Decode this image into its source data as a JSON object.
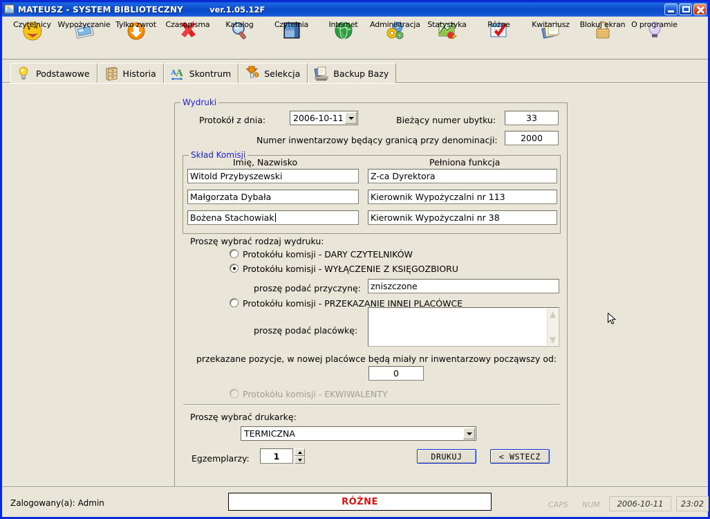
{
  "window": {
    "title": "MATEUSZ - SYSTEM BIBLIOTECZNY",
    "version": "ver.1.05.12F",
    "icon": "application-icon",
    "controls": {
      "minimize": "minimize-button",
      "maximize": "maximize-button",
      "close": "close-button"
    }
  },
  "toolbar": {
    "items": [
      {
        "label": "Czytelnicy",
        "icon": "smiley-face-icon"
      },
      {
        "label": "Wypożyczanie",
        "icon": "book-card-icon"
      },
      {
        "label": "Tylko zwrot",
        "icon": "orange-down-arrow-icon"
      },
      {
        "label": "Czasopisma",
        "icon": "red-x-icon"
      },
      {
        "label": "Katalog",
        "icon": "magnifier-icon"
      },
      {
        "label": "Czytelnia",
        "icon": "map-book-icon"
      },
      {
        "label": "Internet",
        "icon": "globe-icon"
      },
      {
        "label": "Administracja",
        "icon": "gears-icon"
      },
      {
        "label": "Statystyka",
        "icon": "chart-icon"
      },
      {
        "label": "Różne",
        "icon": "calendar-check-icon"
      },
      {
        "label": "Kwitariusz",
        "icon": "documents-icon"
      },
      {
        "label": "Blokuj ekran",
        "icon": "padlock-icon"
      },
      {
        "label": "O programie",
        "icon": "lightbulb-icon"
      }
    ]
  },
  "tabs": [
    {
      "label": "Podstawowe",
      "icon": "lightbulb-icon",
      "selected": true
    },
    {
      "label": "Historia",
      "icon": "file-cabinet-icon",
      "selected": false
    },
    {
      "label": "Skontrum",
      "icon": "font-size-icon",
      "selected": false
    },
    {
      "label": "Selekcja",
      "icon": "funnel-icon",
      "selected": false
    },
    {
      "label": "Backup Bazy",
      "icon": "backup-documents-icon",
      "selected": false
    }
  ],
  "form": {
    "printouts_group_label": "Wydruki",
    "protocol_date_label": "Protokół z dnia:",
    "protocol_date_value": "2006-10-11",
    "current_loss_number_label": "Bieżący numer ubytku:",
    "current_loss_number_value": "33",
    "denomination_limit_label": "Numer inwentarzowy będący granicą przy denominacji:",
    "denomination_limit_value": "2000",
    "committee_group_label": "Skład Komisji",
    "committee_col_name": "Imię, Nazwisko",
    "committee_col_function": "Pełniona funkcja",
    "committee": [
      {
        "name": "Witold Przybyszewski",
        "function": "Z-ca Dyrektora"
      },
      {
        "name": "Małgorzata Dybała",
        "function": "Kierownik Wypożyczalni nr 113"
      },
      {
        "name": "Bożena Stachowiak",
        "function": "Kierownik Wypożyczalni nr 38"
      }
    ],
    "printout_type_label": "Proszę wybrać rodzaj wydruku:",
    "options": [
      {
        "label": "Protokółu komisji - DARY CZYTELNIKÓW",
        "selected": false,
        "disabled": false
      },
      {
        "label": "Protokółu komisji - WYŁĄCZENIE Z KSIĘGOZBIORU",
        "selected": true,
        "disabled": false
      },
      {
        "label": "Protokółu komisji - PRZEKAZANIE INNEJ PLACÓWCE",
        "selected": false,
        "disabled": false
      },
      {
        "label": "Protokółu komisji - EKWIWALENTY",
        "selected": false,
        "disabled": true
      }
    ],
    "reason_label": "proszę podać przyczynę:",
    "reason_value": "zniszczone",
    "institution_label": "proszę podać placówkę:",
    "institution_value": "",
    "transfer_note": "przekazane pozycje, w nowej placówce będą miały nr inwentarzowy począwszy od:",
    "transfer_start_value": "0",
    "printer_label": "Proszę wybrać drukarkę:",
    "printer_value": "TERMICZNA",
    "copies_label": "Egzemplarzy:",
    "copies_value": "1",
    "print_button": "DRUKUJ",
    "back_button": "< WSTECZ"
  },
  "statusbar": {
    "user": "Zalogowany(a): Admin",
    "mode": "RÓŻNE",
    "caps": "CAPS",
    "num": "NUM",
    "date": "2006-10-11",
    "time": "23:02"
  },
  "colors": {
    "titlebar": "#0a49c8",
    "background": "#e9e5d8",
    "group_label": "#1d1ddb",
    "mode_text": "#e01010",
    "button_border": "#0a2ad6"
  }
}
